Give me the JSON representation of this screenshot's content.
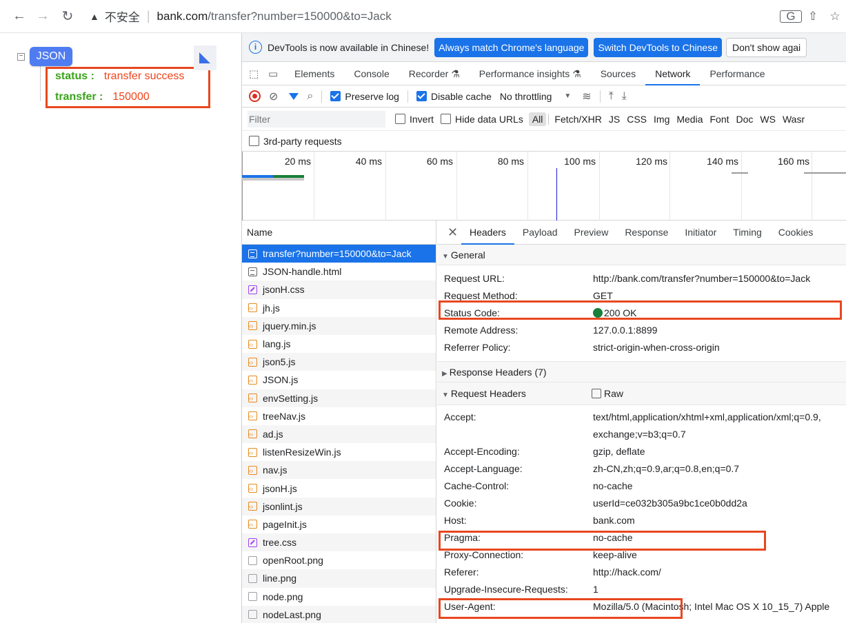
{
  "address_bar": {
    "insecure_label": "不安全",
    "url_host": "bank.com",
    "url_path": "/transfer?number=150000&to=Jack"
  },
  "json_viewer": {
    "badge": "JSON",
    "collapse_glyph": "⊟",
    "rows": [
      {
        "key": "status :",
        "value": "transfer success"
      },
      {
        "key": "transfer :",
        "value": "150000"
      }
    ]
  },
  "devtools": {
    "infobar": {
      "text": "DevTools is now available in Chinese!",
      "btn_match": "Always match Chrome's language",
      "btn_switch": "Switch DevTools to Chinese",
      "btn_dismiss": "Don't show agai"
    },
    "tabs": [
      "Elements",
      "Console",
      "Recorder ⚗",
      "Performance insights ⚗",
      "Sources",
      "Network",
      "Performance"
    ],
    "active_tab": "Network",
    "toolbar": {
      "preserve_log": "Preserve log",
      "disable_cache": "Disable cache",
      "throttling": "No throttling"
    },
    "filter": {
      "placeholder": "Filter",
      "invert": "Invert",
      "hide_data_urls": "Hide data URLs",
      "types": [
        "All",
        "Fetch/XHR",
        "JS",
        "CSS",
        "Img",
        "Media",
        "Font",
        "Doc",
        "WS",
        "Wasr"
      ]
    },
    "third_party": "3rd-party requests",
    "timeline_ticks": [
      "20 ms",
      "40 ms",
      "60 ms",
      "80 ms",
      "100 ms",
      "120 ms",
      "140 ms",
      "160 ms"
    ],
    "list": {
      "header": "Name",
      "items": [
        {
          "name": "transfer?number=150000&to=Jack",
          "type": "doc"
        },
        {
          "name": "JSON-handle.html",
          "type": "doc"
        },
        {
          "name": "jsonH.css",
          "type": "css"
        },
        {
          "name": "jh.js",
          "type": "js"
        },
        {
          "name": "jquery.min.js",
          "type": "js"
        },
        {
          "name": "lang.js",
          "type": "js"
        },
        {
          "name": "json5.js",
          "type": "js"
        },
        {
          "name": "JSON.js",
          "type": "js"
        },
        {
          "name": "envSetting.js",
          "type": "js"
        },
        {
          "name": "treeNav.js",
          "type": "js"
        },
        {
          "name": "ad.js",
          "type": "js"
        },
        {
          "name": "listenResizeWin.js",
          "type": "js"
        },
        {
          "name": "nav.js",
          "type": "js"
        },
        {
          "name": "jsonH.js",
          "type": "js"
        },
        {
          "name": "jsonlint.js",
          "type": "js"
        },
        {
          "name": "pageInit.js",
          "type": "js"
        },
        {
          "name": "tree.css",
          "type": "css"
        },
        {
          "name": "openRoot.png",
          "type": "img"
        },
        {
          "name": "line.png",
          "type": "img"
        },
        {
          "name": "node.png",
          "type": "img"
        },
        {
          "name": "nodeLast.png",
          "type": "img"
        }
      ]
    },
    "details": {
      "tabs": [
        "Headers",
        "Payload",
        "Preview",
        "Response",
        "Initiator",
        "Timing",
        "Cookies"
      ],
      "active_tab": "Headers",
      "general_title": "General",
      "general": [
        {
          "k": "Request URL:",
          "v": "http://bank.com/transfer?number=150000&to=Jack"
        },
        {
          "k": "Request Method:",
          "v": "GET"
        },
        {
          "k": "Status Code:",
          "v": "200 OK"
        },
        {
          "k": "Remote Address:",
          "v": "127.0.0.1:8899"
        },
        {
          "k": "Referrer Policy:",
          "v": "strict-origin-when-cross-origin"
        }
      ],
      "response_headers_title": "Response Headers (7)",
      "request_headers_title": "Request Headers",
      "raw_label": "Raw",
      "request_headers": [
        {
          "k": "Accept:",
          "v": "text/html,application/xhtml+xml,application/xml;q=0.9,"
        },
        {
          "k": "",
          "v": "exchange;v=b3;q=0.7"
        },
        {
          "k": "Accept-Encoding:",
          "v": "gzip, deflate"
        },
        {
          "k": "Accept-Language:",
          "v": "zh-CN,zh;q=0.9,ar;q=0.8,en;q=0.7"
        },
        {
          "k": "Cache-Control:",
          "v": "no-cache"
        },
        {
          "k": "Cookie:",
          "v": "userId=ce032b305a9bc1ce0b0dd2a"
        },
        {
          "k": "Host:",
          "v": "bank.com"
        },
        {
          "k": "Pragma:",
          "v": "no-cache"
        },
        {
          "k": "Proxy-Connection:",
          "v": "keep-alive"
        },
        {
          "k": "Referer:",
          "v": "http://hack.com/"
        },
        {
          "k": "Upgrade-Insecure-Requests:",
          "v": "1"
        },
        {
          "k": "User-Agent:",
          "v": "Mozilla/5.0 (Macintosh; Intel Mac OS X 10_15_7) Apple"
        }
      ]
    }
  },
  "colors": {
    "accent": "#1a73e8",
    "highlight_box": "#e8471f",
    "json_key": "#3aa41b",
    "json_value": "#f0431a",
    "status_ok": "#188038"
  }
}
